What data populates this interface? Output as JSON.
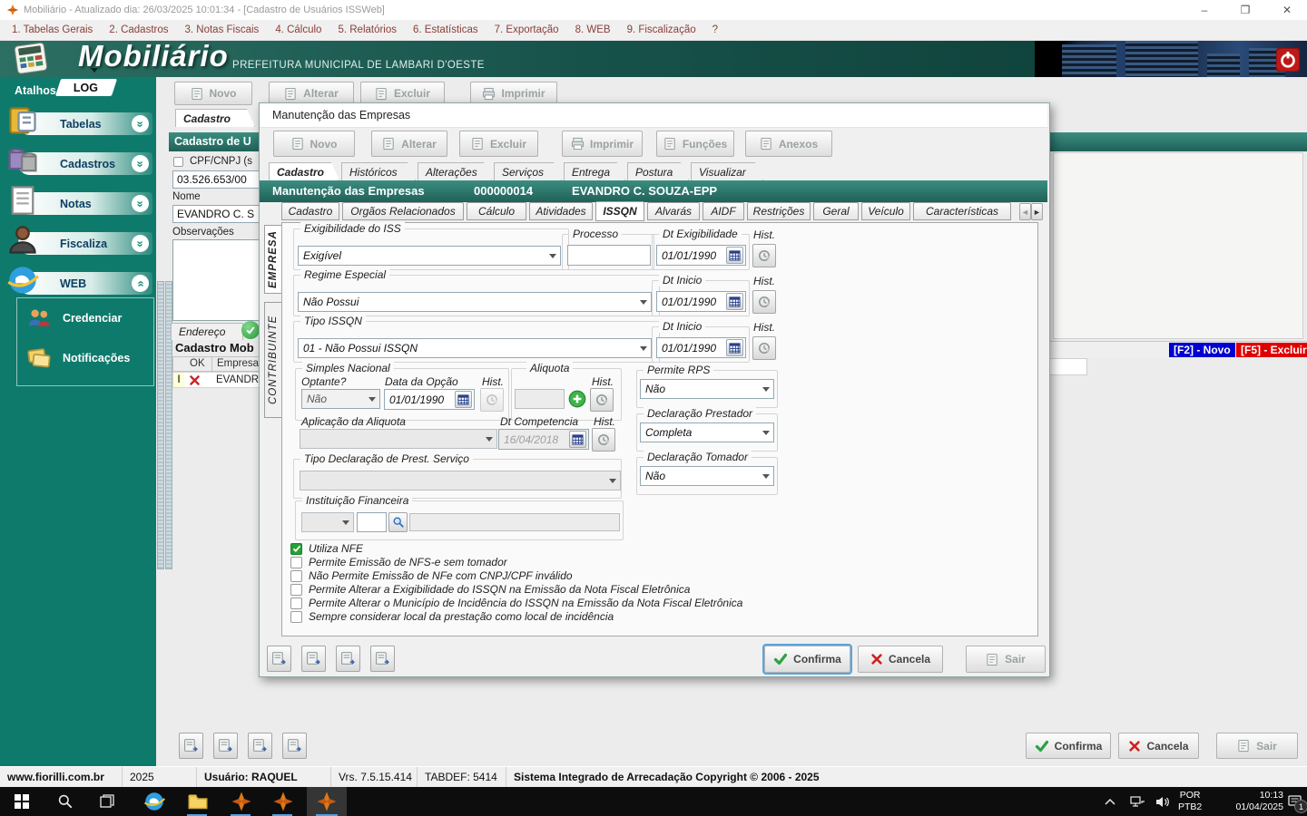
{
  "titlebar": {
    "title": "Mobiliário - Atualizado dia: 26/03/2025 10:01:34 - [Cadastro de Usuários ISSWeb]",
    "minimize": "–",
    "maximize": "❐",
    "close": "✕"
  },
  "menubar": {
    "items": [
      "1. Tabelas Gerais",
      "2. Cadastros",
      "3. Notas Fiscais",
      "4. Cálculo",
      "5. Relatórios",
      "6. Estatísticas",
      "7. Exportação",
      "8. WEB",
      "9. Fiscalização",
      "?"
    ]
  },
  "brand": {
    "app_name": "Mobiliário",
    "subtitle": "PREFEITURA MUNICIPAL DE LAMBARI D'OESTE"
  },
  "sidebar": {
    "atalhos_label": "Atalhos",
    "log_label": "LOG",
    "groups": [
      {
        "label": "Tabelas"
      },
      {
        "label": "Cadastros"
      },
      {
        "label": "Notas"
      },
      {
        "label": "Fiscaliza"
      },
      {
        "label": "WEB"
      }
    ],
    "web_items": [
      {
        "label": "Credenciar"
      },
      {
        "label": "Notificações"
      }
    ]
  },
  "back_window": {
    "toolbar": {
      "novo": "Novo",
      "alterar": "Alterar",
      "excluir": "Excluir",
      "imprimir": "Imprimir"
    },
    "tab_cadastro": "Cadastro",
    "header": "Cadastro de U",
    "cpf_label": "CPF/CNPJ (s",
    "cpf_value": "03.526.653/00",
    "nome_label": "Nome",
    "nome_value": "EVANDRO C. S",
    "obs_label": "Observações",
    "endereco_tab": "Endereço",
    "cadastro_mob": "Cadastro Mob",
    "grid": {
      "col_ok": "OK",
      "col_empresa": "Empresa",
      "cursor": "I",
      "row_value": "EVANDR"
    },
    "f2_label": "[F2] - Novo",
    "f5_label": "[F5] - Excluir",
    "confirma": "Confirma",
    "cancela": "Cancela",
    "sair": "Sair"
  },
  "dialog": {
    "title": "Manutenção das Empresas",
    "toolbar": [
      "Novo",
      "Alterar",
      "Excluir",
      "Imprimir",
      "Funções",
      "Anexos"
    ],
    "tabs": [
      "Cadastro",
      "Históricos",
      "Alterações",
      "Serviços",
      "Entrega",
      "Postura",
      "Visualizar"
    ],
    "header": {
      "title": "Manutenção das Empresas",
      "code": "000000014",
      "name": "EVANDRO C. SOUZA-EPP"
    },
    "inner_tabs": [
      "Cadastro",
      "Orgãos Relacionados",
      "Cálculo",
      "Atividades",
      "ISSQN",
      "Alvarás",
      "AIDF",
      "Restrições",
      "Geral",
      "Veículo",
      "Características"
    ],
    "side_tabs": [
      "EMPRESA",
      "CONTRIBUINTE"
    ],
    "form": {
      "exigibilidade": {
        "group": "Exigibilidade do ISS",
        "value": "Exigível",
        "processo_label": "Processo",
        "dt_label": "Dt Exigibilidade",
        "dt_value": "01/01/1990",
        "hist_label": "Hist."
      },
      "regime": {
        "group": "Regime Especial",
        "value": "Não Possui",
        "dt_label": "Dt Inicio",
        "dt_value": "01/01/1990",
        "hist_label": "Hist."
      },
      "tipo_issqn": {
        "group": "Tipo ISSQN",
        "value": "01 - Não Possui ISSQN",
        "dt_label": "Dt Inicio",
        "dt_value": "01/01/1990",
        "hist_label": "Hist."
      },
      "simples": {
        "group": "Simples Nacional",
        "optante_label": "Optante?",
        "optante_value": "Não",
        "data_opcao_label": "Data da Opção",
        "data_opcao_value": "01/01/1990",
        "hist_label": "Hist."
      },
      "aliquota": {
        "group": "Aliquota",
        "value": "",
        "hist_label": "Hist."
      },
      "permite_rps": {
        "label": "Permite RPS",
        "value": "Não"
      },
      "aplicacao": {
        "label": "Aplicação da Aliquota",
        "value": "",
        "dt_label": "Dt Competencia",
        "dt_value": "16/04/2018",
        "hist_label": "Hist."
      },
      "decl_prestador": {
        "label": "Declaração Prestador",
        "value": "Completa"
      },
      "tipo_decl": {
        "label": "Tipo Declaração de Prest. Serviço",
        "value": ""
      },
      "decl_tomador": {
        "label": "Declaração Tomador",
        "value": "Não"
      },
      "inst_financeira": {
        "label": "Instituição Financeira",
        "code_value": "",
        "name_value": ""
      },
      "checkboxes": [
        {
          "label": "Utiliza NFE",
          "checked": true
        },
        {
          "label": "Permite Emissão de NFS-e sem tomador",
          "checked": false
        },
        {
          "label": "Não Permite Emissão de NFe com CNPJ/CPF inválido",
          "checked": false
        },
        {
          "label": "Permite Alterar a Exigibilidade do ISSQN na Emissão da Nota Fiscal Eletrônica",
          "checked": false
        },
        {
          "label": "Permite Alterar o Município de Incidência do ISSQN na Emissão da Nota Fiscal Eletrônica",
          "checked": false
        },
        {
          "label": "Sempre considerar local da prestação como local de incidência",
          "checked": false
        }
      ]
    },
    "buttons": {
      "confirma": "Confirma",
      "cancela": "Cancela",
      "sair": "Sair"
    }
  },
  "statusbar": {
    "segments": [
      "www.fiorilli.com.br",
      "2025",
      "Usuário: RAQUEL",
      "Vrs. 7.5.15.414",
      "TABDEF: 5414",
      "Sistema Integrado de Arrecadação Copyright © 2006 - 2025"
    ]
  },
  "taskbar": {
    "lang_top": "POR",
    "lang_bottom": "PTB2",
    "time": "10:13",
    "date": "01/04/2025",
    "badge": "1"
  },
  "colors": {
    "teal_header": "#2f7d72",
    "sidebar_teal": "#0e7a6c",
    "f2_blue": "#0000d0",
    "f5_red": "#e00000",
    "check_green": "#27a135"
  }
}
